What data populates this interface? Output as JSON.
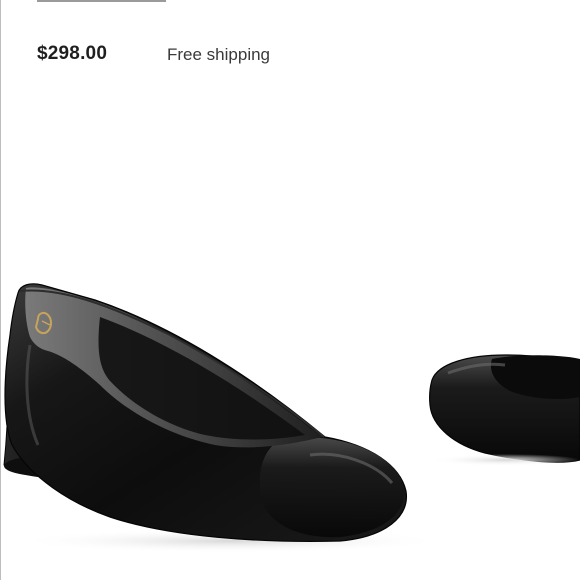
{
  "listing": {
    "price": "$298.00",
    "shipping": "Free shipping",
    "image_icon": "black-leather-block-heel-pump-photo"
  },
  "colors": {
    "price_text": "#1f1f1f",
    "secondary_text": "#3a3a3a",
    "shoe_leather": "#111111",
    "shoe_highlight": "#4a4a4a",
    "shoe_lining": "#6f6f6f",
    "logo_gold": "#c7a45a",
    "background": "#ffffff"
  }
}
